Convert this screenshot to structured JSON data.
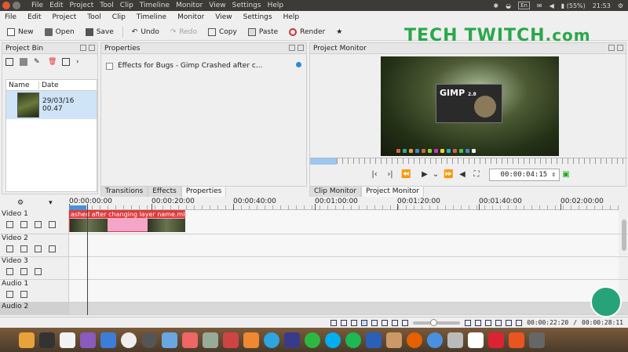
{
  "topbar": {
    "menus": [
      "File",
      "Edit",
      "Project",
      "Tool",
      "Clip",
      "Timeline",
      "Monitor",
      "View",
      "Settings",
      "Help"
    ],
    "lang": "En",
    "battery": "(55%)",
    "time": "21:53"
  },
  "appmenu": [
    "File",
    "Edit",
    "Project",
    "Tool",
    "Clip",
    "Timeline",
    "Monitor",
    "View",
    "Settings",
    "Help"
  ],
  "toolbar": {
    "new": "New",
    "open": "Open",
    "save": "Save",
    "undo": "Undo",
    "redo": "Redo",
    "copy": "Copy",
    "paste": "Paste",
    "render": "Render"
  },
  "watermark": {
    "text1": "TECH",
    "text2": "TWITCH",
    ".com": ".com",
    "suffix": ".com"
  },
  "bin": {
    "title": "Project Bin",
    "col_name": "Name",
    "col_date": "Date",
    "item_date": "29/03/16 00.47"
  },
  "properties": {
    "title": "Properties",
    "effect": "Effects for Bugs - Gimp Crashed after c..."
  },
  "monitor": {
    "title": "Project Monitor",
    "timecode": "00:00:04:15",
    "gimp": "GIMP",
    "gimp_ver": "2.8"
  },
  "midtabs": [
    "Transitions",
    "Effects",
    "Properties"
  ],
  "montabs": [
    "Clip Monitor",
    "Project Monitor"
  ],
  "timeline": {
    "ruler": [
      "00:00:00:00",
      "00:00:20:00",
      "00:00:40:00",
      "00:01:00:00",
      "00:01:20:00",
      "00:01:40:00",
      "00:02:00:00"
    ],
    "tracks": [
      "Video 1",
      "Video 2",
      "Video 3",
      "Audio 1",
      "Audio 2"
    ],
    "clip": "ashed after changing layer name.mkv"
  },
  "status": {
    "pos": "00:00:22:20",
    "sep": "/",
    "dur": "00:00:28:11"
  }
}
